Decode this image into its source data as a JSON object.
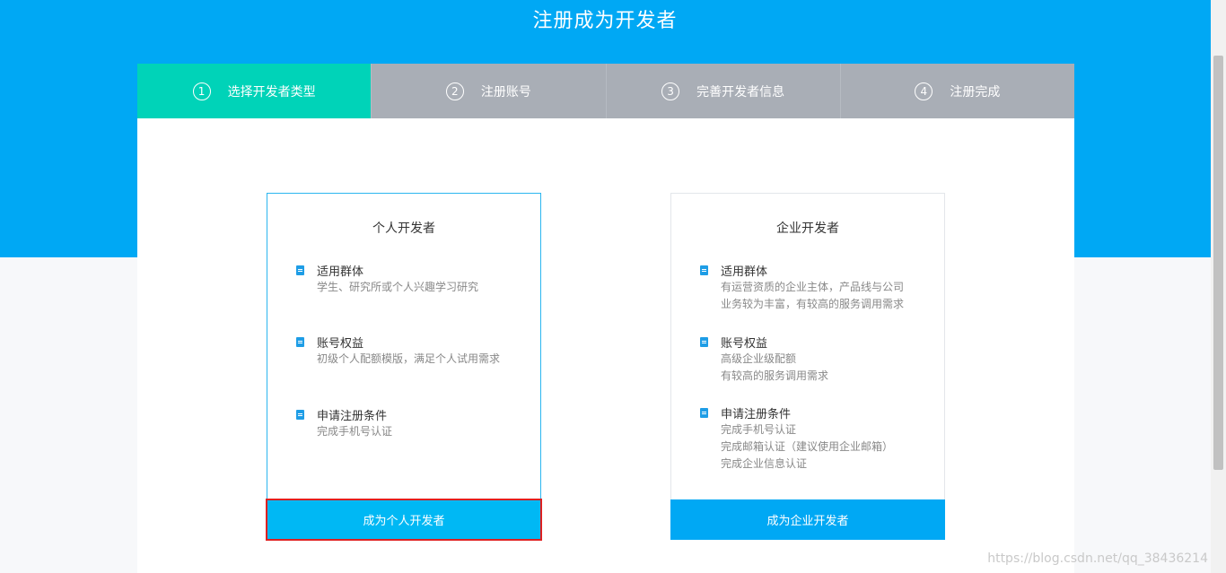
{
  "page": {
    "title": "注册成为开发者"
  },
  "steps": [
    {
      "num": "1",
      "label": "选择开发者类型"
    },
    {
      "num": "2",
      "label": "注册账号"
    },
    {
      "num": "3",
      "label": "完善开发者信息"
    },
    {
      "num": "4",
      "label": "注册完成"
    }
  ],
  "cards": {
    "personal": {
      "title": "个人开发者",
      "audience": {
        "head": "适用群体",
        "lines": [
          "学生、研究所或个人兴趣学习研究"
        ]
      },
      "rights": {
        "head": "账号权益",
        "lines": [
          "初级个人配额模版，满足个人试用需求"
        ]
      },
      "conditions": {
        "head": "申请注册条件",
        "lines": [
          "完成手机号认证"
        ]
      },
      "button": "成为个人开发者"
    },
    "enterprise": {
      "title": "企业开发者",
      "audience": {
        "head": "适用群体",
        "lines": [
          "有运营资质的企业主体，产品线与公司",
          "业务较为丰富，有较高的服务调用需求"
        ]
      },
      "rights": {
        "head": "账号权益",
        "lines": [
          "高级企业级配额",
          "有较高的服务调用需求"
        ]
      },
      "conditions": {
        "head": "申请注册条件",
        "lines": [
          "完成手机号认证",
          "完成邮箱认证（建议使用企业邮箱）",
          "完成企业信息认证"
        ]
      },
      "button": "成为企业开发者"
    }
  },
  "watermark": "https://blog.csdn.net/qq_38436214",
  "colors": {
    "hero": "#00a8f4",
    "active_step": "#00d3b8",
    "inactive_step": "#a9aeb6",
    "highlight": "#e02020"
  }
}
